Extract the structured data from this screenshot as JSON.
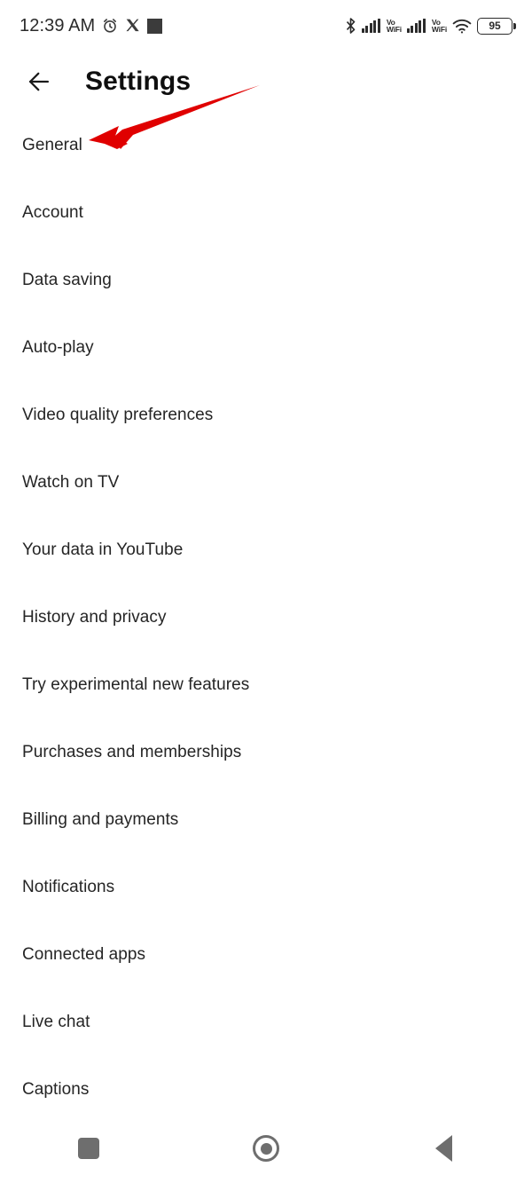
{
  "status_bar": {
    "clock": "12:39 AM",
    "battery_level": "95",
    "volte_label_line1": "Vo",
    "volte_label_line2": "WiFi",
    "icons": [
      "alarm-icon",
      "x-app-icon",
      "app-notification-icon",
      "bluetooth-icon",
      "signal-bars-sim1-icon",
      "vowifi-sim1-icon",
      "signal-bars-sim2-icon",
      "vowifi-sim2-icon",
      "wifi-icon",
      "battery-icon"
    ]
  },
  "app_bar": {
    "title": "Settings",
    "back_icon": "arrow-left-icon"
  },
  "annotation": {
    "color": "#e00000",
    "target": "General",
    "type": "arrow-pointing-left-down"
  },
  "settings": {
    "items": [
      {
        "label": "General"
      },
      {
        "label": "Account"
      },
      {
        "label": "Data saving"
      },
      {
        "label": "Auto-play"
      },
      {
        "label": "Video quality preferences"
      },
      {
        "label": "Watch on TV"
      },
      {
        "label": "Your data in YouTube"
      },
      {
        "label": "History and privacy"
      },
      {
        "label": "Try experimental new features"
      },
      {
        "label": "Purchases and memberships"
      },
      {
        "label": "Billing and payments"
      },
      {
        "label": "Notifications"
      },
      {
        "label": "Connected apps"
      },
      {
        "label": "Live chat"
      },
      {
        "label": "Captions"
      }
    ]
  },
  "nav_bar": {
    "recents_label": "Recents",
    "home_label": "Home",
    "back_label": "Back"
  }
}
